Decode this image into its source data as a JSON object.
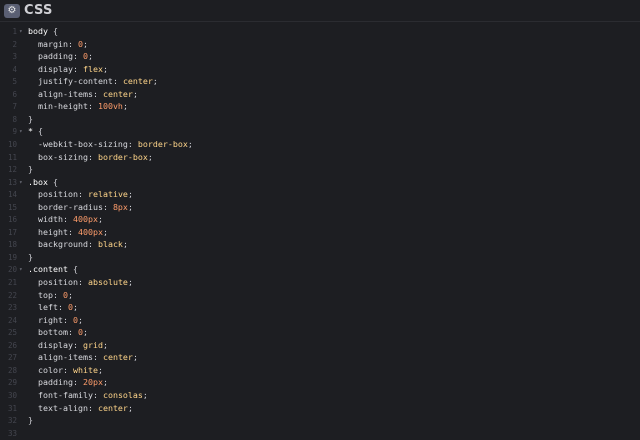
{
  "header": {
    "title": "CSS",
    "settings_icon": "gear-icon"
  },
  "editor": {
    "lines": [
      {
        "n": "1",
        "fold": true,
        "sel": "body",
        "open": true
      },
      {
        "n": "2",
        "prop": "margin",
        "val": "0",
        "num": true
      },
      {
        "n": "3",
        "prop": "padding",
        "val": "0",
        "num": true
      },
      {
        "n": "4",
        "prop": "display",
        "val": "flex"
      },
      {
        "n": "5",
        "prop": "justify-content",
        "val": "center"
      },
      {
        "n": "6",
        "prop": "align-items",
        "val": "center"
      },
      {
        "n": "7",
        "prop": "min-height",
        "val": "100vh",
        "num": true
      },
      {
        "n": "8",
        "close": true
      },
      {
        "n": "9",
        "fold": true,
        "sel": "*",
        "open": true
      },
      {
        "n": "10",
        "prop": "-webkit-box-sizing",
        "val": "border-box"
      },
      {
        "n": "11",
        "prop": "box-sizing",
        "val": "border-box"
      },
      {
        "n": "12",
        "close": true
      },
      {
        "n": "13",
        "fold": true,
        "sel": ".box",
        "open": true
      },
      {
        "n": "14",
        "prop": "position",
        "val": "relative"
      },
      {
        "n": "15",
        "prop": "border-radius",
        "val": "8px",
        "num": true
      },
      {
        "n": "16",
        "prop": "width",
        "val": "400px",
        "num": true
      },
      {
        "n": "17",
        "prop": "height",
        "val": "400px",
        "num": true
      },
      {
        "n": "18",
        "prop": "background",
        "val": "black"
      },
      {
        "n": "19",
        "close": true
      },
      {
        "n": "20",
        "fold": true,
        "sel": ".content",
        "open": true
      },
      {
        "n": "21",
        "prop": "position",
        "val": "absolute"
      },
      {
        "n": "22",
        "prop": "top",
        "val": "0",
        "num": true
      },
      {
        "n": "23",
        "prop": "left",
        "val": "0",
        "num": true
      },
      {
        "n": "24",
        "prop": "right",
        "val": "0",
        "num": true
      },
      {
        "n": "25",
        "prop": "bottom",
        "val": "0",
        "num": true
      },
      {
        "n": "26",
        "prop": "display",
        "val": "grid"
      },
      {
        "n": "27",
        "prop": "align-items",
        "val": "center"
      },
      {
        "n": "28",
        "prop": "color",
        "val": "white"
      },
      {
        "n": "29",
        "prop": "padding",
        "val": "20px",
        "num": true
      },
      {
        "n": "30",
        "prop": "font-family",
        "val": "consolas"
      },
      {
        "n": "31",
        "prop": "text-align",
        "val": "center"
      },
      {
        "n": "32",
        "close": true
      },
      {
        "n": "33"
      }
    ]
  }
}
